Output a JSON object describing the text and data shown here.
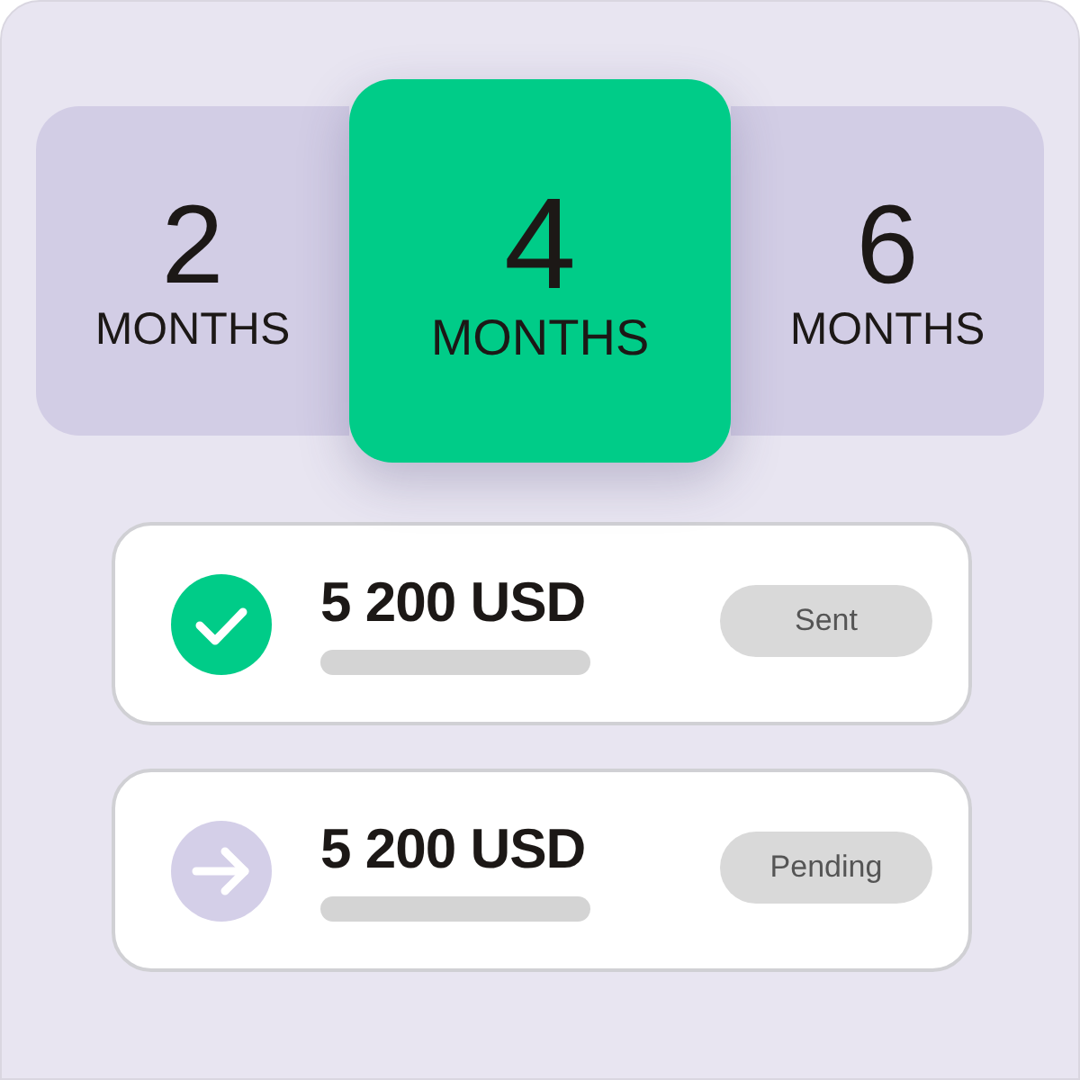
{
  "plans": [
    {
      "number": "2",
      "unit": "MONTHS",
      "selected": false
    },
    {
      "number": "4",
      "unit": "MONTHS",
      "selected": true
    },
    {
      "number": "6",
      "unit": "MONTHS",
      "selected": false
    }
  ],
  "payments": [
    {
      "kind": "sent",
      "amount": "5 200 USD",
      "status": "Sent"
    },
    {
      "kind": "pending",
      "amount": "5 200 USD",
      "status": "Pending"
    }
  ]
}
